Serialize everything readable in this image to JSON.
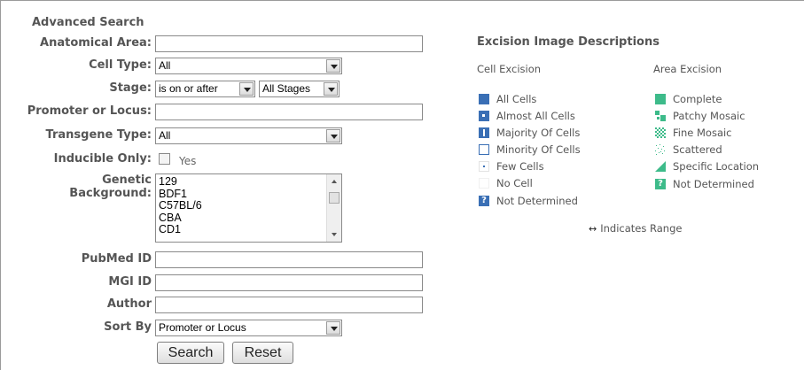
{
  "form": {
    "title": "Advanced Search",
    "anatomical_area_label": "Anatomical Area:",
    "anatomical_area_value": "",
    "cell_type_label": "Cell Type:",
    "cell_type_value": "All",
    "stage_label": "Stage:",
    "stage_operator_value": "is on or after",
    "stage_value": "All Stages",
    "promoter_label": "Promoter or Locus:",
    "promoter_value": "",
    "transgene_type_label": "Transgene Type:",
    "transgene_type_value": "All",
    "inducible_label": "Inducible Only:",
    "inducible_option": "Yes",
    "inducible_checked": false,
    "genetic_label_line1": "Genetic",
    "genetic_label_line2": "Background:",
    "genetic_options": [
      "129",
      "BDF1",
      "C57BL/6",
      "CBA",
      "CD1"
    ],
    "pubmed_label": "PubMed ID",
    "pubmed_value": "",
    "mgi_label": "MGI ID",
    "mgi_value": "",
    "author_label": "Author",
    "author_value": "",
    "sort_label": "Sort By",
    "sort_value": "Promoter or Locus",
    "search_button": "Search",
    "reset_button": "Reset"
  },
  "legend": {
    "title": "Excision Image Descriptions",
    "cell_heading": "Cell Excision",
    "area_heading": "Area Excision",
    "cell_items": [
      {
        "label": "All Cells",
        "icon": "all-cells-icon"
      },
      {
        "label": "Almost All Cells",
        "icon": "almost-all-cells-icon"
      },
      {
        "label": "Majority Of Cells",
        "icon": "majority-cells-icon"
      },
      {
        "label": "Minority Of Cells",
        "icon": "minority-cells-icon"
      },
      {
        "label": "Few Cells",
        "icon": "few-cells-icon"
      },
      {
        "label": "No Cell",
        "icon": "no-cell-icon"
      },
      {
        "label": "Not Determined",
        "icon": "question-icon"
      }
    ],
    "area_items": [
      {
        "label": "Complete",
        "icon": "complete-icon"
      },
      {
        "label": "Patchy Mosaic",
        "icon": "patchy-mosaic-icon"
      },
      {
        "label": "Fine Mosaic",
        "icon": "fine-mosaic-icon"
      },
      {
        "label": "Scattered",
        "icon": "scattered-icon"
      },
      {
        "label": "Specific Location",
        "icon": "specific-location-icon"
      },
      {
        "label": "Not Determined",
        "icon": "question-icon"
      }
    ],
    "range_symbol": "↔",
    "range_note": "Indicates Range"
  },
  "colors": {
    "cell_blue": "#3a6fb5",
    "area_green": "#3dbb8a"
  }
}
